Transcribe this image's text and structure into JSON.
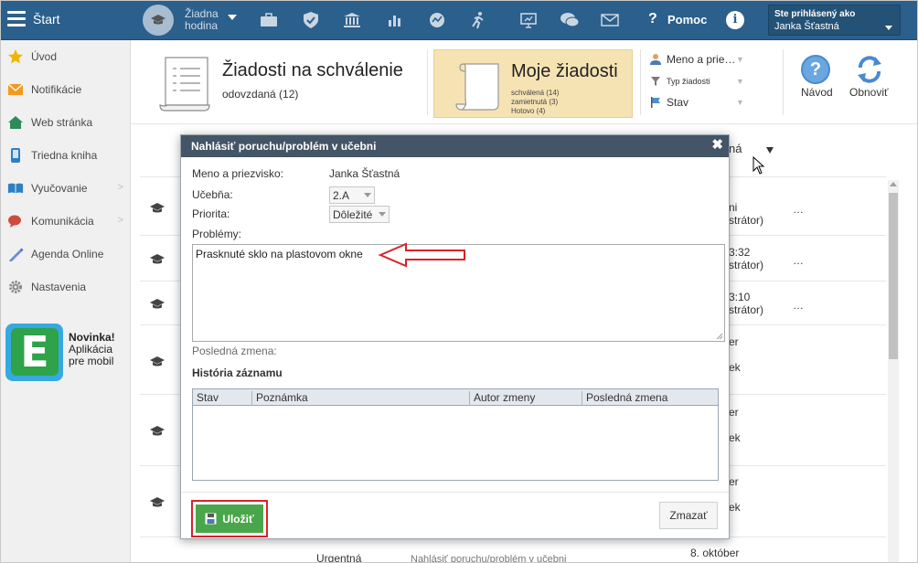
{
  "topbar": {
    "start_label": "Štart",
    "hodina_label_1": "Žiadna",
    "hodina_label_2": "hodina",
    "help_label": "Pomoc",
    "user_caption": "Ste prihlásený ako",
    "user_name": "Janka Šťastná",
    "icons": [
      "briefcase-icon",
      "shield-icon",
      "bank-icon",
      "bar-chart-icon",
      "analytics-icon",
      "running-icon",
      "projector-icon",
      "chat-icon",
      "mail-icon"
    ]
  },
  "sidebar": {
    "items": [
      {
        "label": "Úvod",
        "icon": "star-icon"
      },
      {
        "label": "Notifikácie",
        "icon": "envelope-icon"
      },
      {
        "label": "Web stránka",
        "icon": "home-icon"
      },
      {
        "label": "Triedna kniha",
        "icon": "phone-icon"
      },
      {
        "label": "Vyučovanie",
        "icon": "book-icon"
      },
      {
        "label": "Komunikácia",
        "icon": "chat-icon"
      },
      {
        "label": "Agenda Online",
        "icon": "pen-icon"
      },
      {
        "label": "Nastavenia",
        "icon": "gear-icon"
      }
    ],
    "promo_title": "Novinka!",
    "promo_text_1": "Aplikácia",
    "promo_text_2": "pre mobil",
    "promo_logo_letter": "E"
  },
  "header": {
    "pending_title": "Žiadosti na schválenie",
    "pending_sub": "odovzdaná (12)",
    "mine_title": "Moje žiadosti",
    "mine_status_1": "schválená (14)",
    "mine_status_2": "zamietnutá (3)",
    "mine_status_3": "Hotovo (4)",
    "filter_name": "Meno a prie…",
    "filter_type": "Typ žiadosti",
    "filter_state": "Stav",
    "help_label": "Návod",
    "refresh_label": "Obnoviť"
  },
  "table": {
    "column_head_fragment": "ná",
    "rows": [
      {
        "a": "ni",
        "b": "strátor)",
        "c": "…"
      },
      {
        "a": "3:32",
        "b": "strátor)",
        "c": "…"
      },
      {
        "a": "3:10",
        "b": "strátor)",
        "c": "…"
      },
      {
        "a": "er",
        "b": "ek"
      },
      {
        "a": "er",
        "b": "ek"
      },
      {
        "a": "er",
        "b": "ek"
      }
    ],
    "bottom_priority": "Urgentná",
    "bottom_type": "Nahlásiť poruchu/problém v učebni",
    "bottom_date": "8. október"
  },
  "modal": {
    "title": "Nahlásiť poruchu/problém v učebni",
    "name_label": "Meno a priezvisko:",
    "name_value": "Janka Šťastná",
    "room_label": "Učebňa:",
    "room_value": "2.A",
    "priority_label": "Priorita:",
    "priority_value": "Dôležité",
    "problems_label": "Problémy:",
    "problems_value": "Prasknuté sklo na plastovom okne",
    "last_change_label": "Posledná zmena:",
    "history_title": "História záznamu",
    "history_columns": [
      "Stav",
      "Poznámka",
      "Autor zmeny",
      "Posledná zmena"
    ],
    "save_label": "Uložiť",
    "delete_label": "Zmazať"
  },
  "colors": {
    "topbar": "#2b5f8c",
    "modal_header": "#435567",
    "save_button": "#4aa64a",
    "highlight_red": "#d9222a",
    "mine_tab": "#f6e3b4"
  }
}
